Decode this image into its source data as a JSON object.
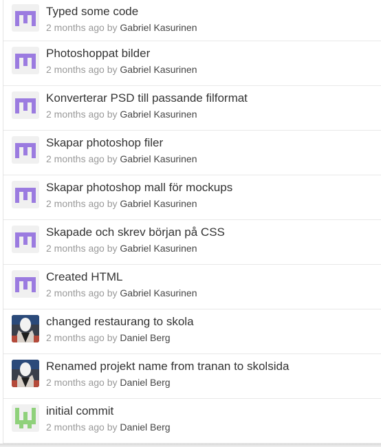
{
  "commits": [
    {
      "message": "Typed some code",
      "time": "2 months ago",
      "by": "by",
      "author": "Gabriel Kasurinen",
      "avatar": "identicon-purple"
    },
    {
      "message": "Photoshoppat bilder",
      "time": "2 months ago",
      "by": "by",
      "author": "Gabriel Kasurinen",
      "avatar": "identicon-purple"
    },
    {
      "message": "Konverterar PSD till passande filformat",
      "time": "2 months ago",
      "by": "by",
      "author": "Gabriel Kasurinen",
      "avatar": "identicon-purple"
    },
    {
      "message": "Skapar photoshop filer",
      "time": "2 months ago",
      "by": "by",
      "author": "Gabriel Kasurinen",
      "avatar": "identicon-purple"
    },
    {
      "message": "Skapar photoshop mall för mockups",
      "time": "2 months ago",
      "by": "by",
      "author": "Gabriel Kasurinen",
      "avatar": "identicon-purple"
    },
    {
      "message": "Skapade och skrev början på CSS",
      "time": "2 months ago",
      "by": "by",
      "author": "Gabriel Kasurinen",
      "avatar": "identicon-purple"
    },
    {
      "message": "Created HTML",
      "time": "2 months ago",
      "by": "by",
      "author": "Gabriel Kasurinen",
      "avatar": "identicon-purple"
    },
    {
      "message": "changed restaurang to skola",
      "time": "2 months ago",
      "by": "by",
      "author": "Daniel Berg",
      "avatar": "photo-avatar"
    },
    {
      "message": "Renamed projekt name from tranan to skolsida",
      "time": "2 months ago",
      "by": "by",
      "author": "Daniel Berg",
      "avatar": "photo-avatar"
    },
    {
      "message": "initial commit",
      "time": "2 months ago",
      "by": "by",
      "author": "Daniel Berg",
      "avatar": "identicon-green"
    }
  ],
  "colors": {
    "identicon_purple": "#9b7be0",
    "identicon_green": "#8fd17b",
    "identicon_bg": "#f0f0f0"
  }
}
